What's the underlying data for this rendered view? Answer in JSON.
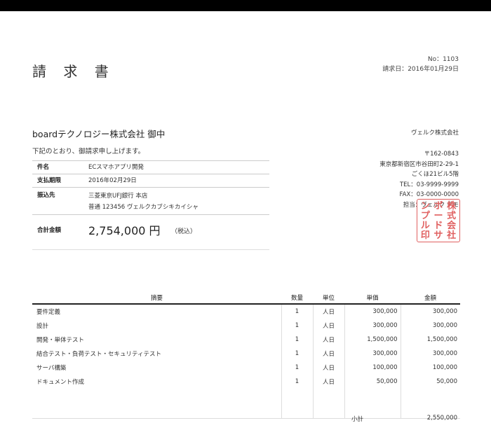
{
  "document": {
    "title": "請 求 書",
    "number_line": "No：1103",
    "date_line": "請求日：2016年01月29日"
  },
  "client": {
    "name": "boardテクノロジー株式会社 御中",
    "greeting": "下記のとおり、御請求申し上げます。"
  },
  "issuer": {
    "company": "ヴェルク株式会社",
    "postal": "〒162-0843",
    "address": "東京都新宿区市谷田町2-29-1",
    "building": "ごくほ21ビル5階",
    "tel": "TEL：03-9999-9999",
    "fax": "FAX：03-0000-0000",
    "contact": "担当：ヴェルク デモ"
  },
  "info": {
    "subject_label": "件名",
    "subject_value": "ECスマホアプリ開発",
    "due_label": "支払期限",
    "due_value": "2016年02月29日",
    "bank_label": "振込先",
    "bank_line1": "三菱東京UFJ銀行 本店",
    "bank_line2": "普通 123456 ヴェルクカブシキカイシャ"
  },
  "total": {
    "label": "合計金額",
    "amount": "2,754,000 円",
    "tax_note": "（税込）"
  },
  "stamp": {
    "text": "株式会社ボードサンプル印",
    "chars": [
      "株",
      "ボ",
      "ン",
      "式",
      "ー",
      "プ",
      "会",
      "ド",
      "ル",
      "社",
      "サ",
      "印"
    ]
  },
  "table": {
    "headers": [
      "摘要",
      "数量",
      "単位",
      "単価",
      "金額"
    ],
    "rows": [
      {
        "desc": "要件定義",
        "qty": "1",
        "unit": "人日",
        "price": "300,000",
        "amount": "300,000"
      },
      {
        "desc": "設計",
        "qty": "1",
        "unit": "人日",
        "price": "300,000",
        "amount": "300,000"
      },
      {
        "desc": "開発・単体テスト",
        "qty": "1",
        "unit": "人日",
        "price": "1,500,000",
        "amount": "1,500,000"
      },
      {
        "desc": "結合テスト・負荷テスト・セキュリティテスト",
        "qty": "1",
        "unit": "人日",
        "price": "300,000",
        "amount": "300,000"
      },
      {
        "desc": "サーバ構築",
        "qty": "1",
        "unit": "人日",
        "price": "100,000",
        "amount": "100,000"
      },
      {
        "desc": "ドキュメント作成",
        "qty": "1",
        "unit": "人日",
        "price": "50,000",
        "amount": "50,000"
      }
    ]
  },
  "subtotal": {
    "label": "小計",
    "value": "2,550,000"
  }
}
